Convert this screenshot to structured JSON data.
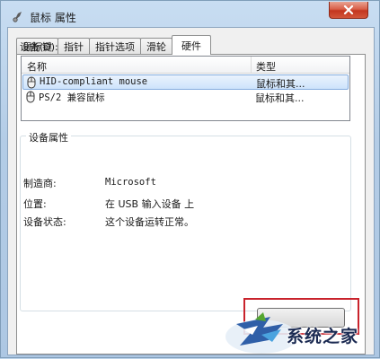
{
  "window": {
    "title": "鼠标 属性"
  },
  "tabs": [
    {
      "label": "鼠标键",
      "active": false
    },
    {
      "label": "指针",
      "active": false
    },
    {
      "label": "指针选项",
      "active": false
    },
    {
      "label": "滑轮",
      "active": false
    },
    {
      "label": "硬件",
      "active": true
    }
  ],
  "devices": {
    "label": "设备(D):",
    "columns": {
      "name": "名称",
      "type": "类型"
    },
    "rows": [
      {
        "name": "HID-compliant mouse",
        "type": "鼠标和其...",
        "selected": true
      },
      {
        "name": "PS/2 兼容鼠标",
        "type": "鼠标和其...",
        "selected": false
      }
    ]
  },
  "properties": {
    "title": "设备属性",
    "manufacturer_label": "制造商:",
    "manufacturer_value": "Microsoft",
    "location_label": "位置:",
    "location_value": "在 USB 输入设备 上",
    "status_label": "设备状态:",
    "status_value": "这个设备运转正常。"
  },
  "watermark": {
    "text": "系统之家"
  },
  "colors": {
    "highlight": "#c9232c",
    "selection": "#cde3fb",
    "close_button": "#c3361f"
  }
}
